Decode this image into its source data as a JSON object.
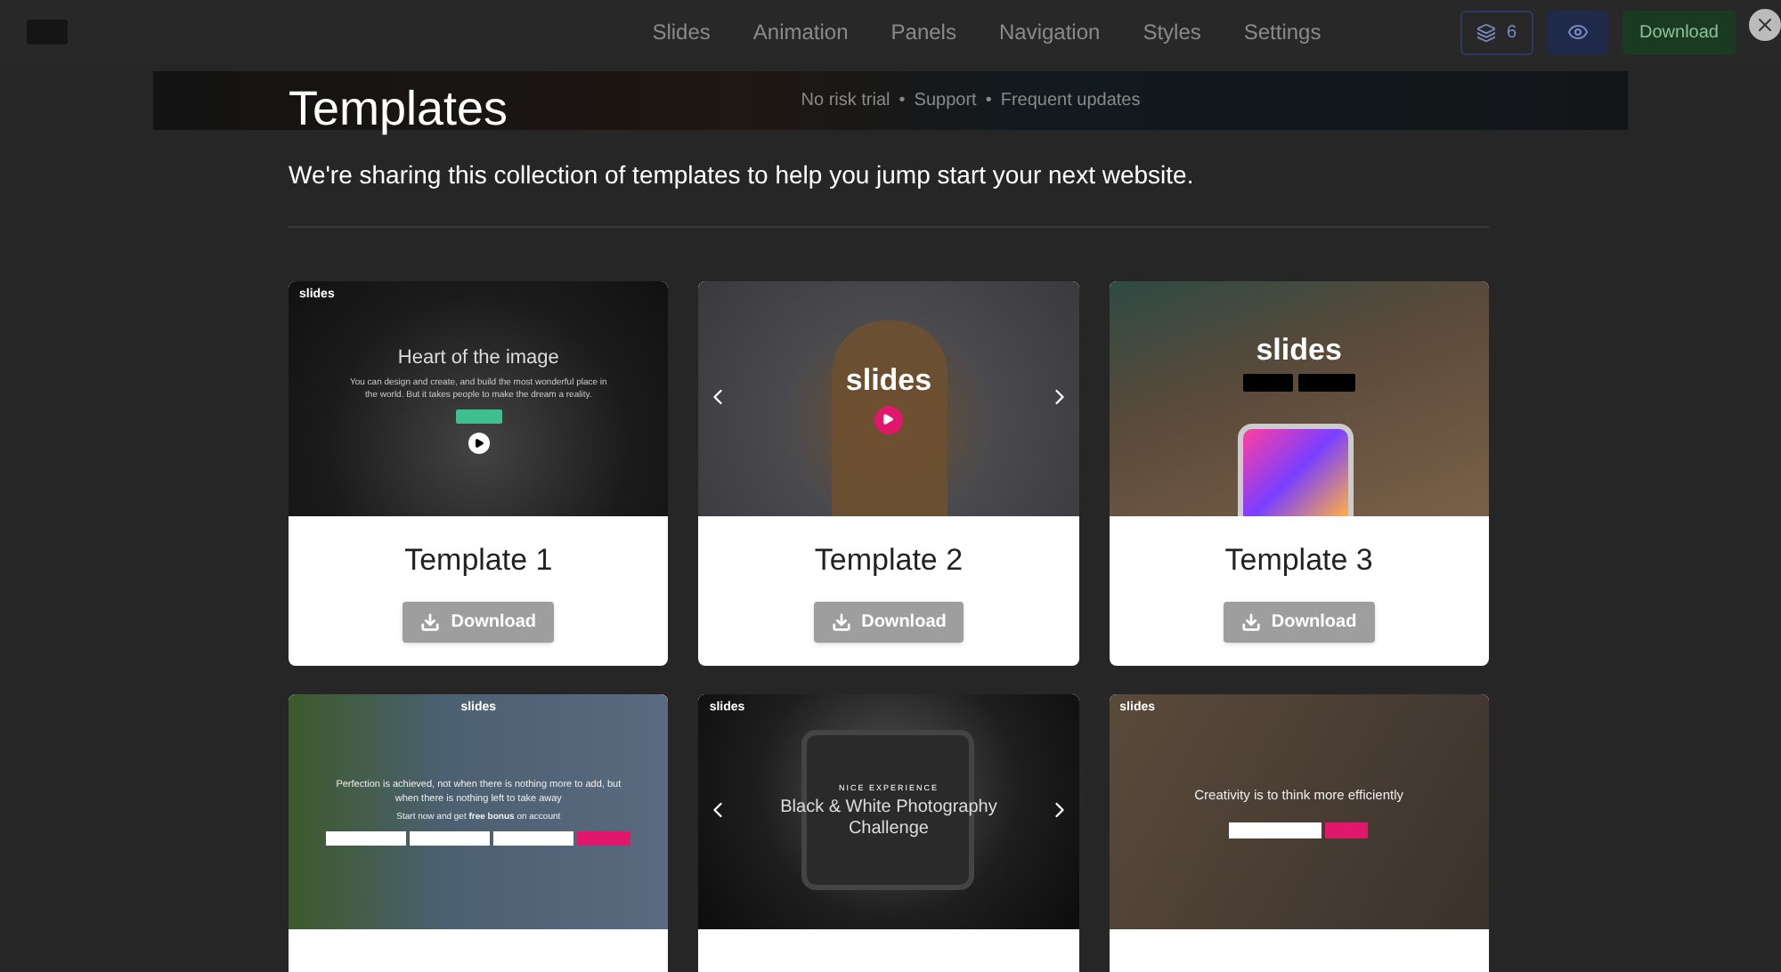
{
  "navbar": {
    "menu": [
      "Slides",
      "Animation",
      "Panels",
      "Navigation",
      "Styles",
      "Settings"
    ],
    "layers_count": "6",
    "download_label": "Download"
  },
  "banner": {
    "items": [
      "No risk trial",
      "•",
      "Support",
      "•",
      "Frequent updates"
    ]
  },
  "modal": {
    "title": "Templates",
    "subtitle": "We're sharing this collection of templates to help you jump start your next website.",
    "templates": [
      {
        "kind": "hero",
        "name": "Template 1",
        "logo": "slides",
        "headline": "Heart of the image",
        "text": "You can design and create, and build the most wonderful place in the world. But it takes people to make the dream a reality.",
        "download": "Download"
      },
      {
        "kind": "video",
        "name": "Template 2",
        "logo": "slides",
        "download": "Download"
      },
      {
        "kind": "app",
        "name": "Template 3",
        "logo": "slides",
        "download": "Download"
      },
      {
        "kind": "signup",
        "logo": "slides",
        "text": "Perfection is achieved, not when there is nothing more to add, but when there is nothing left to take away",
        "note": "Start now and get **free bonus** on account"
      },
      {
        "kind": "gallery",
        "logo": "slides",
        "eyebrow": "NICE EXPERIENCE",
        "headline": "Black & White Photography Challenge"
      },
      {
        "kind": "landing",
        "logo": "slides",
        "headline": "Creativity is to think more efficiently"
      }
    ]
  }
}
